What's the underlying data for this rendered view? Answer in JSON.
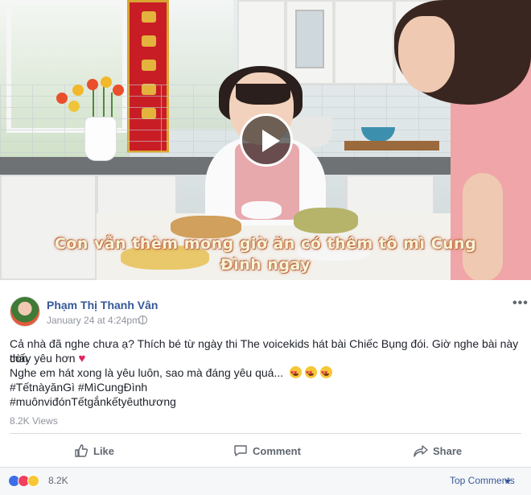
{
  "video": {
    "subtitle_line1": "Con vẫn thèm mong giờ ăn có thêm tô mì Cung",
    "subtitle_line2": "Đình ngay"
  },
  "post": {
    "author": "Phạm Thị Thanh Vân",
    "timestamp": "January 24 at 4:24pm",
    "line1": "Cả nhà đã nghe chưa ạ? Thích bé từ ngày thi The voicekids hát bài Chiếc Bụng đói. Giờ nghe bài này còn",
    "line2": "thấy yêu hơn",
    "line3": "Nghe em hát xong là yêu luôn, sao mà đáng yêu quá...",
    "hashtags_line1": "#TếtnàyănGì #MìCungĐình",
    "hashtags_line2": "#muônviđónTếtgắnkếtyêuthương",
    "views": "8.2K Views"
  },
  "actions": {
    "like": "Like",
    "comment": "Comment",
    "share": "Share"
  },
  "footer": {
    "reaction_count": "8.2K",
    "sort_label": "Top Comments"
  },
  "colors": {
    "link": "#365899",
    "muted": "#90949c",
    "heart": "#e0245e"
  }
}
